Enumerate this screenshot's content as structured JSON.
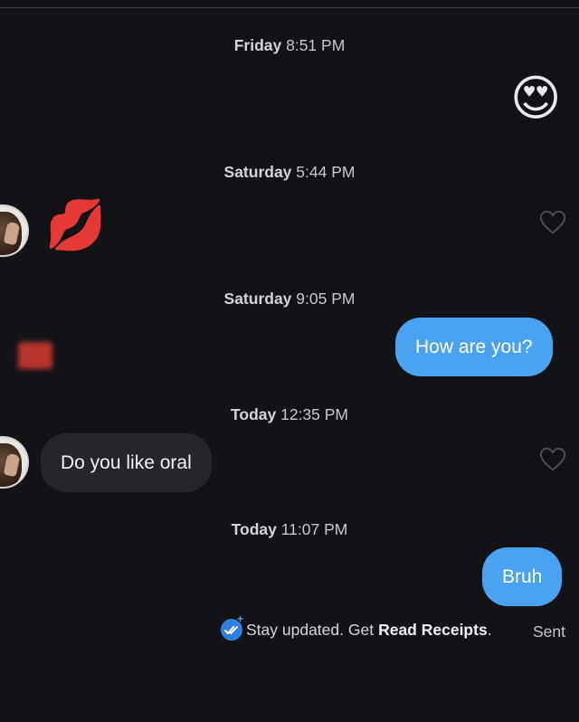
{
  "messages": [
    {
      "stamp_day": "Friday",
      "stamp_time": "8:51 PM",
      "emoji": "😍",
      "direction": "out"
    },
    {
      "stamp_day": "Saturday",
      "stamp_time": "5:44 PM",
      "emoji": "💋",
      "direction": "in"
    },
    {
      "stamp_day": "Saturday",
      "stamp_time": "9:05 PM",
      "text": "How are you?",
      "direction": "out"
    },
    {
      "stamp_day": "Today",
      "stamp_time": "12:35 PM",
      "text": "Do you like oral",
      "direction": "in"
    },
    {
      "stamp_day": "Today",
      "stamp_time": "11:07 PM",
      "text": "Bruh",
      "direction": "out"
    }
  ],
  "read_receipts": {
    "text": "Stay updated. Get",
    "link": "Read Receipts",
    "period": "."
  },
  "status": "Sent",
  "colors": {
    "background": "#111317",
    "outgoing_bubble": "#4aa3f1",
    "incoming_bubble": "#24262c"
  }
}
